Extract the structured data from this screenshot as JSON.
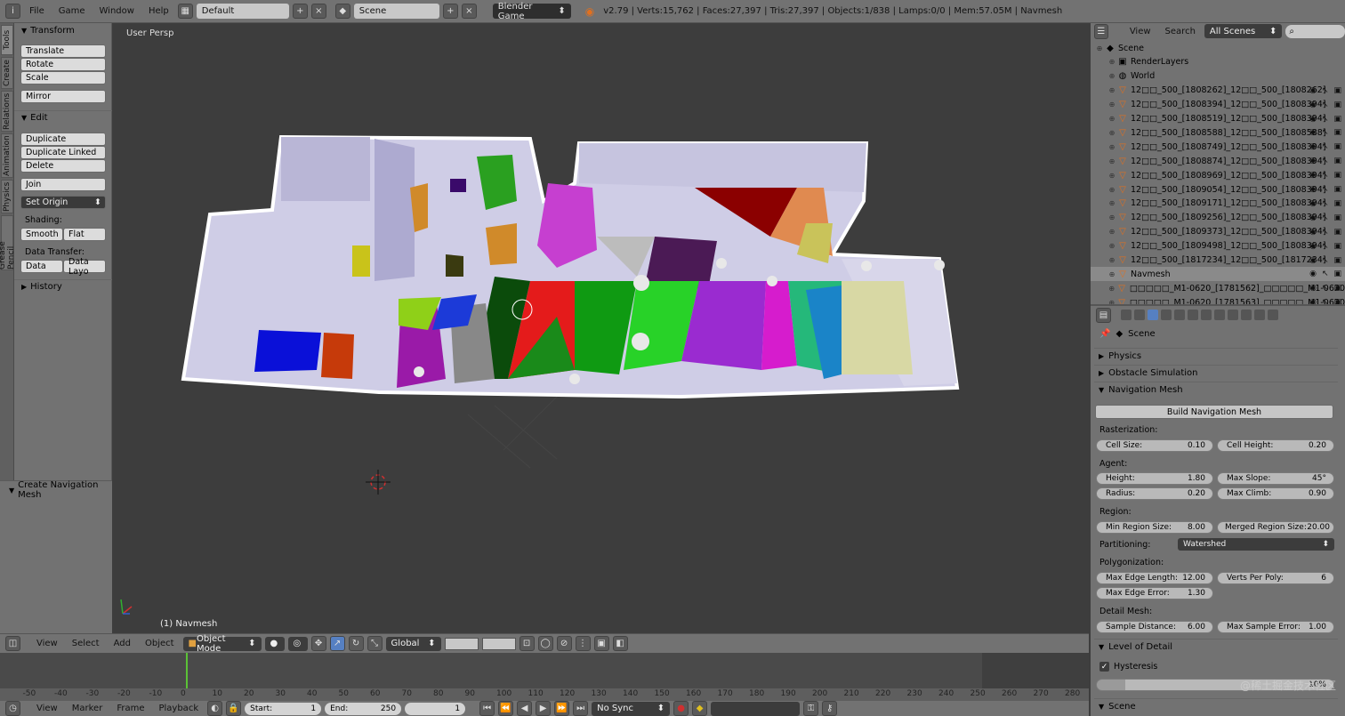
{
  "topbar": {
    "menus": [
      "File",
      "Game",
      "Window",
      "Help"
    ],
    "layout": "Default",
    "scene": "Scene",
    "engine": "Blender Game",
    "stats": "v2.79 | Verts:15,762 | Faces:27,397 | Tris:27,397 | Objects:1/838 | Lamps:0/0 | Mem:57.05M | Navmesh"
  },
  "left_tabs": [
    "Tools",
    "Create",
    "Relations",
    "Animation",
    "Physics",
    "Grease Pencil"
  ],
  "toolshelf": {
    "transform_title": "Transform",
    "translate": "Translate",
    "rotate": "Rotate",
    "scale": "Scale",
    "mirror": "Mirror",
    "edit_title": "Edit",
    "duplicate": "Duplicate",
    "duplicate_linked": "Duplicate Linked",
    "delete": "Delete",
    "join": "Join",
    "set_origin": "Set Origin",
    "shading_label": "Shading:",
    "smooth": "Smooth",
    "flat": "Flat",
    "data_transfer_label": "Data Transfer:",
    "data": "Data",
    "data_layout": "Data Layo",
    "history_title": "History"
  },
  "redo_panel": {
    "title": "Create Navigation Mesh"
  },
  "viewport": {
    "view_label": "User Persp",
    "object_label": "(1) Navmesh"
  },
  "viewport_header": {
    "menus": [
      "View",
      "Select",
      "Add",
      "Object"
    ],
    "mode": "Object Mode",
    "orientation": "Global"
  },
  "timeline": {
    "ticks": [
      "-50",
      "-40",
      "-30",
      "-20",
      "-10",
      "0",
      "10",
      "20",
      "30",
      "40",
      "50",
      "60",
      "70",
      "80",
      "90",
      "100",
      "110",
      "120",
      "130",
      "140",
      "150",
      "160",
      "170",
      "180",
      "190",
      "200",
      "210",
      "220",
      "230",
      "240",
      "250",
      "260",
      "270",
      "280"
    ],
    "menus": [
      "View",
      "Marker",
      "Frame",
      "Playback"
    ],
    "start_label": "Start:",
    "start_value": "1",
    "end_label": "End:",
    "end_value": "250",
    "current_frame": "1",
    "sync": "No Sync"
  },
  "outliner": {
    "menus": [
      "View",
      "Search"
    ],
    "scenes_dropdown": "All Scenes",
    "rows": [
      {
        "label": "Scene",
        "level": 0,
        "icon": "scene-icon"
      },
      {
        "label": "RenderLayers",
        "level": 1,
        "icon": "renderlayers-icon"
      },
      {
        "label": "World",
        "level": 1,
        "icon": "world-icon"
      },
      {
        "label": "12□□_500_[1808262]_12□□_500_[1808262]",
        "level": 1,
        "icon": "mesh-icon"
      },
      {
        "label": "12□□_500_[1808394]_12□□_500_[1808394]",
        "level": 1,
        "icon": "mesh-icon"
      },
      {
        "label": "12□□_500_[1808519]_12□□_500_[1808394]",
        "level": 1,
        "icon": "mesh-icon"
      },
      {
        "label": "12□□_500_[1808588]_12□□_500_[1808588]",
        "level": 1,
        "icon": "mesh-icon"
      },
      {
        "label": "12□□_500_[1808749]_12□□_500_[1808394]",
        "level": 1,
        "icon": "mesh-icon"
      },
      {
        "label": "12□□_500_[1808874]_12□□_500_[1808394]",
        "level": 1,
        "icon": "mesh-icon"
      },
      {
        "label": "12□□_500_[1808969]_12□□_500_[1808394]",
        "level": 1,
        "icon": "mesh-icon"
      },
      {
        "label": "12□□_500_[1809054]_12□□_500_[1808394]",
        "level": 1,
        "icon": "mesh-icon"
      },
      {
        "label": "12□□_500_[1809171]_12□□_500_[1808394]",
        "level": 1,
        "icon": "mesh-icon"
      },
      {
        "label": "12□□_500_[1809256]_12□□_500_[1808394]",
        "level": 1,
        "icon": "mesh-icon"
      },
      {
        "label": "12□□_500_[1809373]_12□□_500_[1808394]",
        "level": 1,
        "icon": "mesh-icon"
      },
      {
        "label": "12□□_500_[1809498]_12□□_500_[1808394]",
        "level": 1,
        "icon": "mesh-icon"
      },
      {
        "label": "12□□_500_[1817234]_12□□_500_[1817234]",
        "level": 1,
        "icon": "mesh-icon"
      },
      {
        "label": "Navmesh",
        "level": 1,
        "icon": "mesh-icon"
      },
      {
        "label": "□□□□□_M1-0620_[1781562]_□□□□□_M1-0620",
        "level": 1,
        "icon": "mesh-icon"
      },
      {
        "label": "□□□□□_M1-0620_[1781563]_□□□□□_M1-0620",
        "level": 1,
        "icon": "mesh-icon"
      }
    ]
  },
  "properties": {
    "context": "Scene",
    "physics": "Physics",
    "obstacle": "Obstacle Simulation",
    "navmesh": "Navigation Mesh",
    "build_button": "Build Navigation Mesh",
    "rasterization_label": "Rasterization:",
    "cell_size": {
      "label": "Cell Size:",
      "value": "0.10"
    },
    "cell_height": {
      "label": "Cell Height:",
      "value": "0.20"
    },
    "agent_label": "Agent:",
    "height": {
      "label": "Height:",
      "value": "1.80"
    },
    "max_slope": {
      "label": "Max Slope:",
      "value": "45°"
    },
    "radius": {
      "label": "Radius:",
      "value": "0.20"
    },
    "max_climb": {
      "label": "Max Climb:",
      "value": "0.90"
    },
    "region_label": "Region:",
    "min_region": {
      "label": "Min Region Size:",
      "value": "8.00"
    },
    "merged_region": {
      "label": "Merged Region Size:",
      "value": "20.00"
    },
    "partitioning_label": "Partitioning:",
    "partitioning_value": "Watershed",
    "polygonization_label": "Polygonization:",
    "max_edge_length": {
      "label": "Max Edge Length:",
      "value": "12.00"
    },
    "verts_per_poly": {
      "label": "Verts Per Poly:",
      "value": "6"
    },
    "max_edge_error": {
      "label": "Max Edge Error:",
      "value": "1.30"
    },
    "detail_label": "Detail Mesh:",
    "sample_distance": {
      "label": "Sample Distance:",
      "value": "6.00"
    },
    "max_sample_error": {
      "label": "Max Sample Error:",
      "value": "1.00"
    },
    "lod": "Level of Detail",
    "hysteresis": "Hysteresis",
    "hysteresis_value": "10%",
    "scene_panel": "Scene"
  },
  "watermark": "@稀土掘金技术社区"
}
